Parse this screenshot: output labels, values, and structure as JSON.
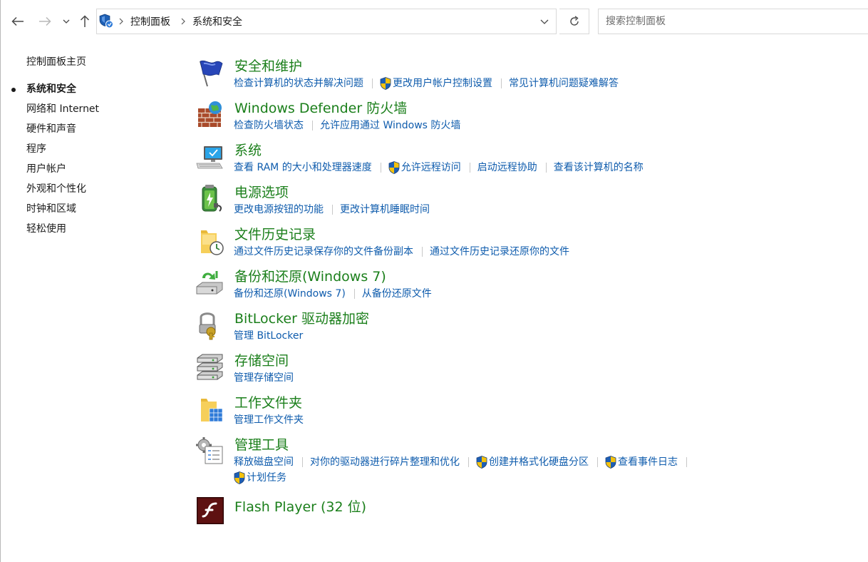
{
  "address": {
    "crumbs": [
      "控制面板",
      "系统和安全"
    ]
  },
  "search": {
    "placeholder": "搜索控制面板"
  },
  "sidebar": {
    "home": "控制面板主页",
    "items": [
      {
        "label": "系统和安全",
        "current": true
      },
      {
        "label": "网络和 Internet"
      },
      {
        "label": "硬件和声音"
      },
      {
        "label": "程序"
      },
      {
        "label": "用户帐户"
      },
      {
        "label": "外观和个性化"
      },
      {
        "label": "时钟和区域"
      },
      {
        "label": "轻松使用"
      }
    ]
  },
  "colors": {
    "title_green": "#1b7f1b",
    "link_blue": "#0f5cad",
    "text": "#1b1b1b"
  },
  "categories": [
    {
      "title": "安全和维护",
      "icon": "security-flag-icon",
      "links": [
        "检查计算机的状态并解决问题",
        "更改用户帐户控制设置",
        "常见计算机问题疑难解答"
      ]
    },
    {
      "title": "Windows Defender 防火墙",
      "icon": "firewall-icon",
      "links": [
        "检查防火墙状态",
        "允许应用通过 Windows 防火墙"
      ]
    },
    {
      "title": "系统",
      "icon": "computer-icon",
      "links": [
        "查看 RAM 的大小和处理器速度",
        "允许远程访问",
        "启动远程协助",
        "查看该计算机的名称"
      ]
    },
    {
      "title": "电源选项",
      "icon": "power-battery-icon",
      "links": [
        "更改电源按钮的功能",
        "更改计算机睡眠时间"
      ]
    },
    {
      "title": "文件历史记录",
      "icon": "file-history-icon",
      "links": [
        "通过文件历史记录保存你的文件备份副本",
        "通过文件历史记录还原你的文件"
      ]
    },
    {
      "title": "备份和还原(Windows 7)",
      "icon": "backup-restore-icon",
      "links": [
        "备份和还原(Windows 7)",
        "从备份还原文件"
      ]
    },
    {
      "title": "BitLocker 驱动器加密",
      "icon": "bitlocker-key-icon",
      "links": [
        "管理 BitLocker"
      ]
    },
    {
      "title": "存储空间",
      "icon": "storage-spaces-icon",
      "links": [
        "管理存储空间"
      ]
    },
    {
      "title": "工作文件夹",
      "icon": "work-folders-icon",
      "links": [
        "管理工作文件夹"
      ]
    },
    {
      "title": "管理工具",
      "icon": "admin-tools-icon",
      "links": [
        "释放磁盘空间",
        "对你的驱动器进行碎片整理和优化",
        "创建并格式化硬盘分区",
        "查看事件日志",
        "计划任务"
      ]
    },
    {
      "title": "Flash Player (32 位)",
      "icon": "flash-player-icon",
      "links": []
    }
  ]
}
